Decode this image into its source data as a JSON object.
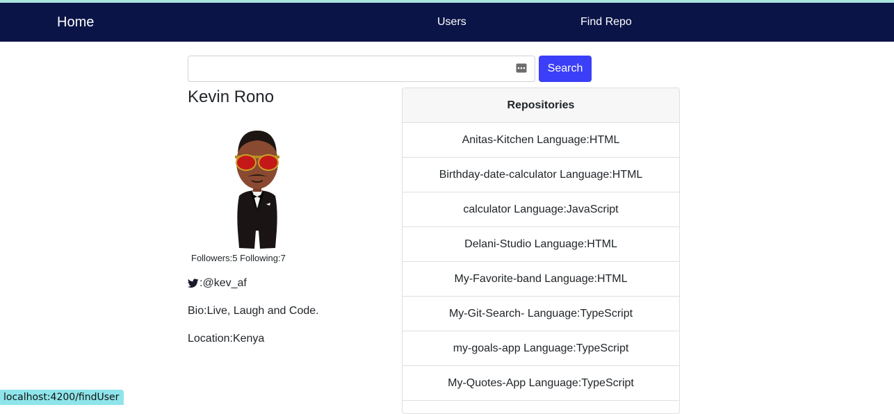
{
  "nav": {
    "brand": "Home",
    "links": [
      "Users",
      "Find Repo"
    ]
  },
  "search": {
    "value": "",
    "placeholder": "",
    "button_label": "Search"
  },
  "profile": {
    "name": "Kevin Rono",
    "followers_text": "Followers:5 Following:7",
    "twitter_handle": ":@kev_af",
    "bio": "Bio:Live, Laugh and Code.",
    "location": "Location:Kenya"
  },
  "repositories": {
    "header": "Repositories",
    "items": [
      "Anitas-Kitchen Language:HTML",
      "Birthday-date-calculator Language:HTML",
      "calculator Language:JavaScript",
      "Delani-Studio Language:HTML",
      "My-Favorite-band Language:HTML",
      "My-Git-Search- Language:TypeScript",
      "my-goals-app Language:TypeScript",
      "My-Quotes-App Language:TypeScript"
    ]
  },
  "status_bar": {
    "url": "localhost:4200/findUser"
  },
  "colors": {
    "navbar": "#0b1447",
    "search_button": "#3b3ff7",
    "status_bar": "#8ee4ea"
  }
}
